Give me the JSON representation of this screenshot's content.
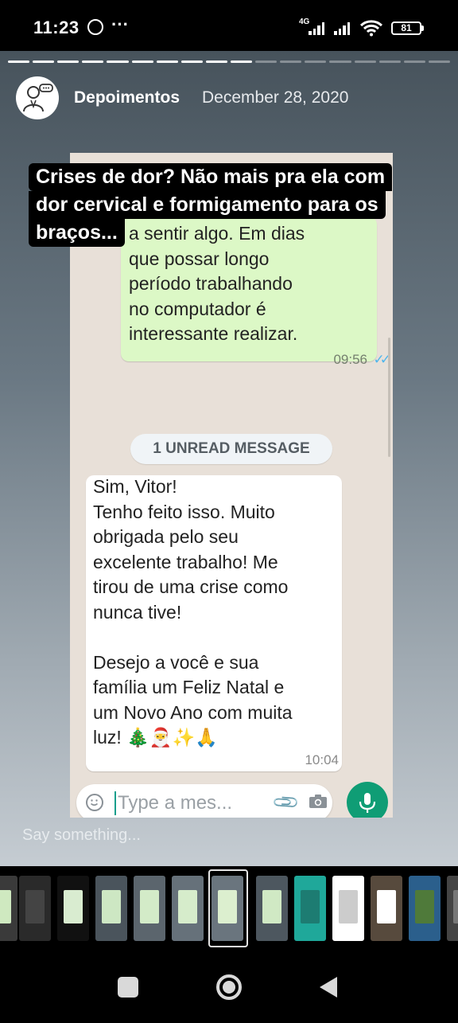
{
  "status_bar": {
    "time": "11:23",
    "network_type": "4G",
    "battery": "81"
  },
  "story": {
    "username": "Depoimentos",
    "date": "December 28, 2020",
    "segments_total": 18,
    "segments_viewed": 10,
    "reply_placeholder": "Say something..."
  },
  "caption": {
    "lines": [
      "Crises de dor? Não mais pra ela com",
      "dor cervical e formigamento para os",
      "braços..."
    ]
  },
  "chat": {
    "outgoing": {
      "text": "a sentir algo. Em dias\nque possar longo\nperíodo trabalhando\nno computador é\ninteressante realizar.",
      "time": "09:56"
    },
    "unread_label": "1 UNREAD MESSAGE",
    "incoming": {
      "text": "Sim, Vitor!\nTenho feito isso. Muito\nobrigada pelo seu\nexcelente trabalho! Me\ntirou de uma crise como\nnunca tive!\n\nDesejo a você e sua\nfamília um Feliz Natal e\num Novo Ano com muita\nluz! 🎄🎅✨🙏",
      "time": "10:04"
    },
    "input_placeholder": "Type a mes..."
  },
  "colors": {
    "outgoing_bubble": "#dcf8c6",
    "chat_background": "#e8e0d8",
    "mic_button": "#0f9d75",
    "read_ticks": "#4fb6ec"
  }
}
